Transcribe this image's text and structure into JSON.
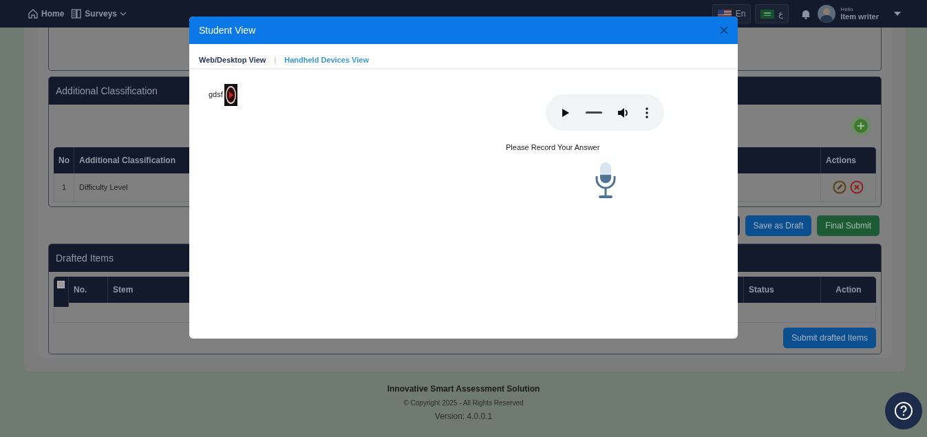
{
  "navbar": {
    "links": [
      {
        "label": "Home",
        "kind": "home"
      },
      {
        "label": "Surveys",
        "kind": "dropdown"
      }
    ],
    "languages": [
      {
        "label": "En",
        "kind": "us"
      },
      {
        "label": "ع",
        "kind": "sa"
      }
    ],
    "user": {
      "greeting": "Hello",
      "name": "Item writer"
    }
  },
  "classification": {
    "title": "Additional Classification",
    "columns": [
      "No",
      "Additional Classification",
      "Actions"
    ],
    "rows": [
      {
        "no": "1",
        "name": "Difficulty Level"
      }
    ]
  },
  "form_buttons": [
    {
      "label": "Save as Draft",
      "kind": "primary"
    },
    {
      "label": "Final Submit",
      "kind": "success"
    }
  ],
  "drafted": {
    "title": "Drafted Items",
    "select_all_checked": false,
    "columns": [
      "No.",
      "Stem",
      "Status",
      "Action"
    ],
    "submit": "Submit drafted Items"
  },
  "footer": {
    "title": "Innovative Smart Assessment Solution",
    "copyright": "© Copyright 2025 - All Rights Reserved",
    "version": "Version: 4.0.0.1"
  },
  "modal": {
    "title": "Student View",
    "tabs": [
      {
        "label": "Web/Desktop View",
        "selected": true
      },
      {
        "label": "Handheld Devices View",
        "selected": false
      }
    ],
    "separator": "|",
    "question": "gdsf",
    "prompt": "Please Record Your Answer"
  }
}
